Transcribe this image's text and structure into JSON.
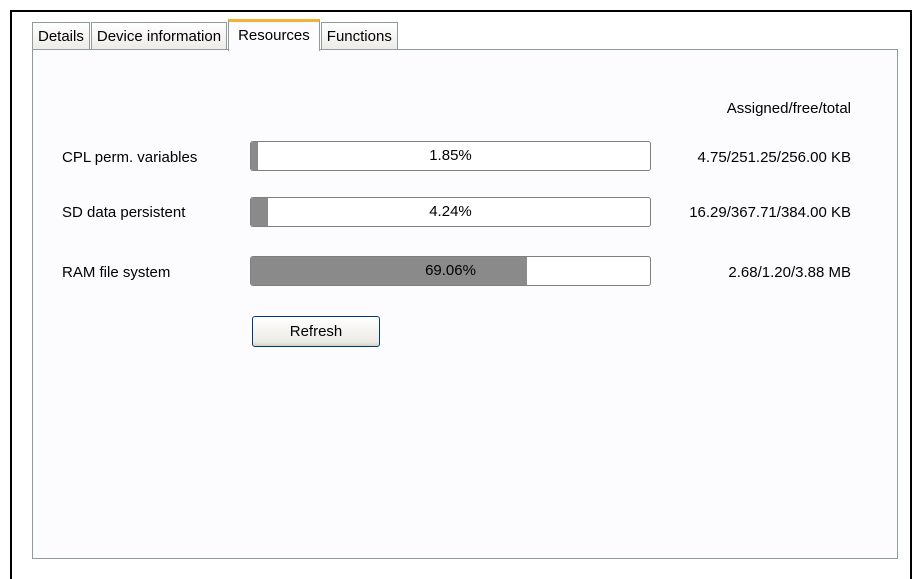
{
  "tabs": [
    {
      "label": "Details",
      "active": false
    },
    {
      "label": "Device information",
      "active": false
    },
    {
      "label": "Resources",
      "active": true
    },
    {
      "label": "Functions",
      "active": false
    }
  ],
  "resources": {
    "header": "Assigned/free/total",
    "rows": [
      {
        "label": "CPL perm. variables",
        "percent_text": "1.85%",
        "fill_fraction": 0.0185,
        "value": "4.75/251.25/256.00 KB"
      },
      {
        "label": "SD data persistent",
        "percent_text": "4.24%",
        "fill_fraction": 0.0424,
        "value": "16.29/367.71/384.00 KB"
      },
      {
        "label": "RAM file system",
        "percent_text": "69.06%",
        "fill_fraction": 0.6906,
        "value": "2.68/1.20/3.88 MB"
      }
    ],
    "refresh_label": "Refresh"
  },
  "colors": {
    "bar_fill": "#8a8a8a",
    "active_tab_accent": "#f2b338",
    "panel_background": "#fcfcfe"
  }
}
